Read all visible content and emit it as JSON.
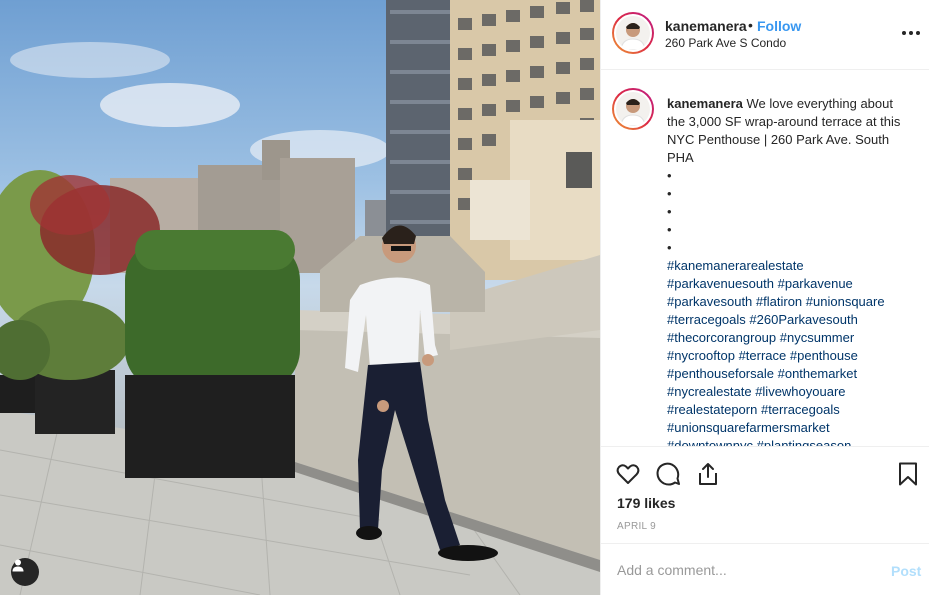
{
  "post": {
    "username": "kanemanera",
    "separator": "•",
    "follow_label": "Follow",
    "location": "260 Park Ave S Condo",
    "more_icon": "more-options-icon"
  },
  "caption": {
    "username": "kanemanera",
    "text": "We love everything about the 3,000 SF wrap-around terrace at this NYC Penthouse | 260 Park Ave. South PHA",
    "bullets": [
      "•",
      "•",
      "•",
      "•",
      "•"
    ],
    "hashtag_lines": [
      [
        "#kanemanerarealestate"
      ],
      [
        "#parkavenuesouth",
        "#parkavenue"
      ],
      [
        "#parkavesouth",
        "#flatiron",
        "#unionsquare"
      ],
      [
        "#terracegoals",
        "#260Parkavesouth"
      ],
      [
        "#thecorcorangroup",
        "#nycsummer"
      ],
      [
        "#nycrooftop",
        "#terrace",
        "#penthouse"
      ],
      [
        "#penthouseforsale",
        "#onthemarket"
      ],
      [
        "#nycrealestate",
        "#livewhoyouare"
      ],
      [
        "#realestateporn",
        "#terracegoals"
      ],
      [
        "#unionsquarefarmersmarket"
      ],
      [
        "#downtownnyc",
        "#plantingseason"
      ]
    ]
  },
  "actions": {
    "icons": [
      "heart-icon",
      "comment-icon",
      "share-icon",
      "bookmark-icon"
    ],
    "likes": "179 likes",
    "date": "APRIL 9"
  },
  "comment": {
    "placeholder": "Add a comment...",
    "post_label": "Post"
  },
  "photo": {
    "user_tag_icon": "user-tag-icon"
  }
}
